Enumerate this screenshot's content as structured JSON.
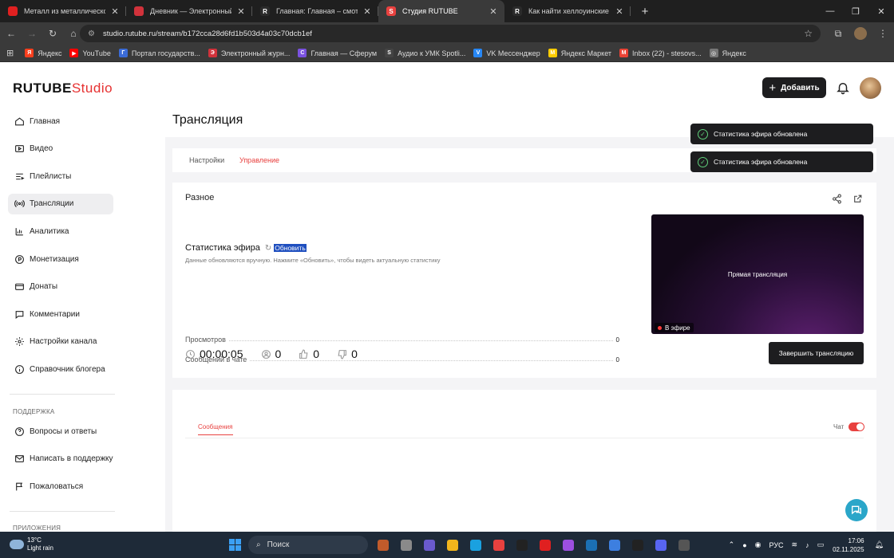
{
  "browser": {
    "tabs": [
      {
        "title": "Металл из металлического по",
        "fav_color": "#e02020",
        "fav_text": "",
        "active": false
      },
      {
        "title": "Дневник — Электронный жур",
        "fav_color": "#d1323b",
        "fav_text": "",
        "active": false
      },
      {
        "title": "Главная: Главная – смотреть о",
        "fav_color": "#2b2b2b",
        "fav_text": "R",
        "active": false
      },
      {
        "title": "Студия RUTUBE",
        "fav_color": "#e8413f",
        "fav_text": "S",
        "active": true
      },
      {
        "title": "Как найти хеллоуинские пред",
        "fav_color": "#2b2b2b",
        "fav_text": "R",
        "active": false
      }
    ],
    "url": "studio.rutube.ru/stream/b172cca28d6fd1b503d4a03c70dcb1ef",
    "bookmarks": [
      {
        "label": "Яндекс",
        "color": "#fc3f1d",
        "text": "Я"
      },
      {
        "label": "YouTube",
        "color": "#ff0000",
        "text": "▶"
      },
      {
        "label": "Портал государств...",
        "color": "#3b6bd6",
        "text": "Г"
      },
      {
        "label": "Электронный журн...",
        "color": "#d1323b",
        "text": "Э"
      },
      {
        "label": "Главная — Сферум",
        "color": "#7b52e0",
        "text": "С"
      },
      {
        "label": "Аудио к УМК Spotli...",
        "color": "#444444",
        "text": "S"
      },
      {
        "label": "VK Мессенджер",
        "color": "#2787f5",
        "text": "V"
      },
      {
        "label": "Яндекс Маркет",
        "color": "#ffcc00",
        "text": "М"
      },
      {
        "label": "Inbox (22) - stesovs...",
        "color": "#ea4335",
        "text": "M"
      },
      {
        "label": "Яндекс",
        "color": "#777777",
        "text": "◎"
      }
    ]
  },
  "app": {
    "logo_main": "RUTUBE",
    "logo_studio": "Studio",
    "add_label": "Добавить",
    "sidebar": {
      "items": [
        {
          "label": "Главная",
          "icon": "home-icon"
        },
        {
          "label": "Видео",
          "icon": "video-icon"
        },
        {
          "label": "Плейлисты",
          "icon": "playlist-icon"
        },
        {
          "label": "Трансляции",
          "icon": "broadcast-icon",
          "active": true
        },
        {
          "label": "Аналитика",
          "icon": "analytics-icon"
        },
        {
          "label": "Монетизация",
          "icon": "monetization-icon"
        },
        {
          "label": "Донаты",
          "icon": "donate-icon"
        },
        {
          "label": "Комментарии",
          "icon": "comments-icon"
        },
        {
          "label": "Настройки канала",
          "icon": "gear-icon"
        },
        {
          "label": "Справочник блогера",
          "icon": "info-icon"
        }
      ],
      "support_title": "ПОДДЕРЖКА",
      "support_items": [
        {
          "label": "Вопросы и ответы",
          "icon": "question-icon"
        },
        {
          "label": "Написать в поддержку",
          "icon": "mail-icon"
        },
        {
          "label": "Пожаловаться",
          "icon": "flag-icon"
        }
      ],
      "apps_title": "ПРИЛОЖЕНИЯ"
    },
    "page_title": "Трансляция",
    "page_tabs": [
      "Настройки",
      "Управление"
    ],
    "toasts": [
      "Статистика эфира обновлена",
      "Статистика эфира обновлена"
    ],
    "misc_title": "Разное",
    "stats": {
      "title": "Статистика эфира",
      "refresh": "Обновить",
      "note": "Данные обновляются вручную. Нажмите «Обновить», чтобы видеть актуальную статистику",
      "rows": [
        {
          "label": "Просмотров",
          "value": "0"
        },
        {
          "label": "Сообщений в чате",
          "value": "0"
        }
      ]
    },
    "metrics": {
      "duration": "00:00:05",
      "viewers": "0",
      "likes": "0",
      "dislikes": "0"
    },
    "preview": {
      "label": "Прямая трансляция",
      "live_badge": "В эфире"
    },
    "end_button": "Завершить трансляцию",
    "chat": {
      "tab": "Сообщения",
      "toggle_label": "Чат"
    }
  },
  "taskbar": {
    "weather_temp": "13°C",
    "weather_desc": "Light rain",
    "search_placeholder": "Поиск",
    "apps": [
      "#c15b2b",
      "#8a8a8a",
      "#6a5acd",
      "#f2b51c",
      "#1aa1e0",
      "#e8413f",
      "#222222",
      "#e02020",
      "#9c4fe0",
      "#1b6fb3",
      "#3d7fe0",
      "#222222",
      "#5865f2",
      "#555555"
    ],
    "lang": "РУС",
    "time": "17:06",
    "date": "02.11.2025"
  }
}
